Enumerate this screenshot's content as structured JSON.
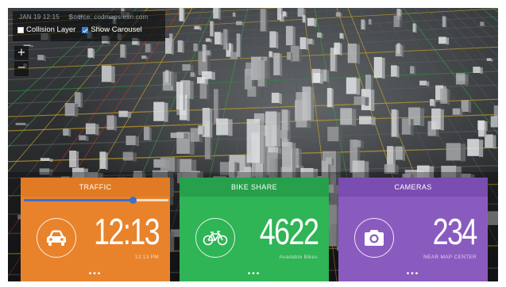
{
  "header": {
    "timestamp": "JAN 19 12:15",
    "source": "Source: codmaps.esri.com"
  },
  "layers": [
    {
      "label": "Collision Layer",
      "checked": false
    },
    {
      "label": "Show Carousel",
      "checked": true
    }
  ],
  "zoom": {
    "in_label": "+",
    "out_label": "−"
  },
  "cards": {
    "traffic": {
      "title": "TRAFFIC",
      "value": "12:13",
      "subtitle": "12:13 PM",
      "icon": "car-icon",
      "color": "#e8832c",
      "slider_fraction": 0.75,
      "more": "•••"
    },
    "bike": {
      "title": "BIKE SHARE",
      "value": "4622",
      "subtitle": "Available Bikes",
      "icon": "bicycle-icon",
      "color": "#2fb456",
      "more": "•••"
    },
    "cameras": {
      "title": "CAMERAS",
      "value": "234",
      "subtitle": "NEAR MAP CENTER",
      "icon": "camera-icon",
      "color": "#8a5bbf",
      "more": "•••"
    }
  }
}
